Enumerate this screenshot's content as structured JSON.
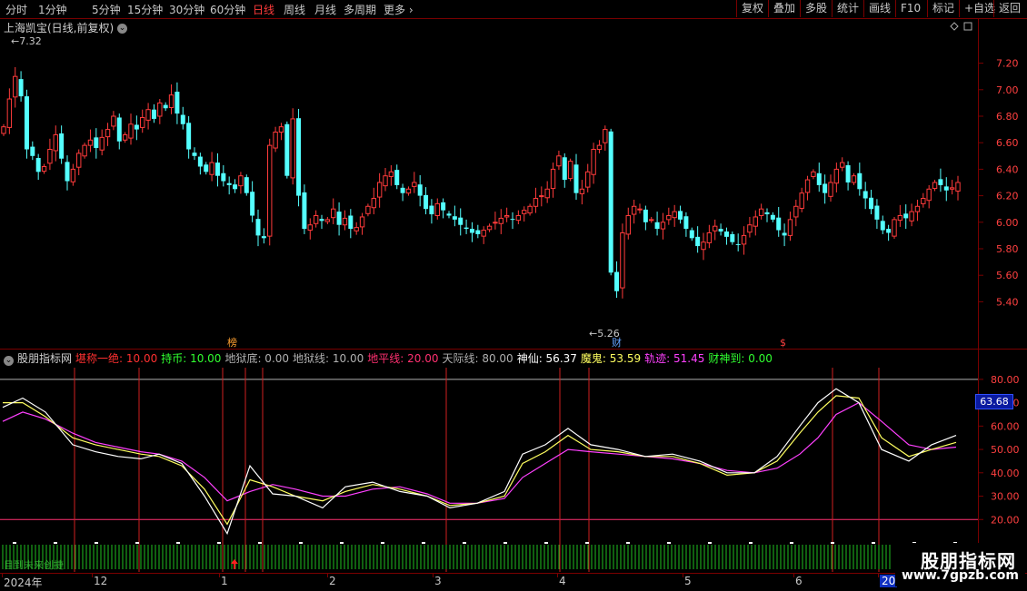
{
  "toolbar": {
    "timeframes": [
      "分时",
      "1分钟",
      "5分钟",
      "15分钟",
      "30分钟",
      "60分钟",
      "日线",
      "周线",
      "月线",
      "多周期",
      "更多"
    ],
    "active": "日线",
    "right_buttons": [
      "复权",
      "叠加",
      "多股",
      "统计",
      "画线",
      "F10",
      "标记",
      "+自选",
      "返回"
    ]
  },
  "main_chart": {
    "title": "上海凯宝(日线,前复权)",
    "high_label": "7.32",
    "low_label": "5.26",
    "y_ticks": [
      "7.20",
      "7.00",
      "6.80",
      "6.60",
      "6.40",
      "6.20",
      "6.00",
      "5.80",
      "5.60",
      "5.40"
    ],
    "markers": [
      "榜",
      "财",
      "$"
    ]
  },
  "indicator": {
    "name": "股朋指标网",
    "params": [
      {
        "label": "堪称一绝: ",
        "value": "10.00",
        "color": "#ff3030"
      },
      {
        "label": "持币: ",
        "value": "10.00",
        "color": "#30ff30"
      },
      {
        "label": "地狱底: ",
        "value": "0.00",
        "color": "#b0b0b0"
      },
      {
        "label": "地狱线: ",
        "value": "10.00",
        "color": "#b0b0b0"
      },
      {
        "label": "地平线: ",
        "value": "20.00",
        "color": "#ff3070"
      },
      {
        "label": "天际线: ",
        "value": "80.00",
        "color": "#b0b0b0"
      },
      {
        "label": "神仙: ",
        "value": "56.37",
        "color": "#ffffff"
      },
      {
        "label": "魔鬼: ",
        "value": "53.59",
        "color": "#ffff60"
      },
      {
        "label": "轨迹: ",
        "value": "51.45",
        "color": "#ff40ff"
      },
      {
        "label": "财神到: ",
        "value": "0.00",
        "color": "#30ff30"
      }
    ],
    "y_ticks": [
      "80.00",
      "70.00",
      "60.00",
      "50.00",
      "40.00",
      "30.00",
      "20.00"
    ],
    "current_value": "63.68",
    "bottom_text": "目到未来创捷"
  },
  "date_axis": {
    "labels": [
      "2024年",
      "12",
      "1",
      "2",
      "3",
      "4",
      "5",
      "6",
      "20"
    ]
  },
  "watermark": {
    "title": "股朋指标网",
    "url": "www.7gpzb.com"
  },
  "colors": {
    "up": "#ff3b3b",
    "down": "#54ffff",
    "grid_border": "#7a0000",
    "active_tab": "#ff3b3b"
  },
  "chart_data": {
    "type": "candlestick",
    "x_period": "daily, 2024-11 to 2025-06",
    "ylim": [
      5.2,
      7.35
    ],
    "close": [
      6.72,
      6.93,
      7.1,
      6.95,
      6.55,
      6.5,
      6.38,
      6.42,
      6.55,
      6.66,
      6.48,
      6.31,
      6.4,
      6.52,
      6.58,
      6.62,
      6.56,
      6.64,
      6.7,
      6.8,
      6.61,
      6.66,
      6.74,
      6.7,
      6.79,
      6.85,
      6.78,
      6.9,
      6.86,
      6.96,
      6.82,
      6.74,
      6.55,
      6.5,
      6.42,
      6.38,
      6.45,
      6.35,
      6.31,
      6.28,
      6.25,
      6.35,
      6.22,
      6.05,
      5.9,
      5.88,
      6.58,
      6.68,
      6.72,
      6.35,
      6.78,
      6.2,
      5.95,
      5.98,
      6.05,
      6.01,
      6.02,
      6.1,
      5.98,
      6.03,
      5.95,
      5.96,
      6.04,
      6.12,
      6.18,
      6.3,
      6.35,
      6.38,
      6.28,
      6.22,
      6.25,
      6.3,
      6.2,
      6.1,
      6.06,
      6.14,
      6.09,
      6.05,
      6.02,
      5.98,
      5.95,
      5.92,
      5.91,
      5.94,
      5.97,
      6.0,
      6.03,
      6.05,
      6.02,
      6.05,
      6.09,
      6.12,
      6.18,
      6.2,
      6.25,
      6.4,
      6.5,
      6.32,
      6.46,
      6.22,
      6.25,
      6.38,
      6.55,
      6.58,
      6.7,
      5.62,
      5.48,
      5.92,
      6.05,
      6.12,
      6.1,
      6.0,
      6.02,
      5.95,
      6.0,
      6.05,
      6.08,
      6.02,
      5.95,
      5.88,
      5.82,
      5.85,
      5.92,
      5.97,
      5.93,
      5.89,
      5.85,
      5.83,
      5.9,
      5.98,
      6.04,
      6.1,
      6.06,
      6.02,
      5.94,
      5.9,
      6.02,
      6.12,
      6.22,
      6.32,
      6.38,
      6.28,
      6.22,
      6.3,
      6.4,
      6.45,
      6.3,
      6.35,
      6.25,
      6.18,
      6.1,
      6.02,
      5.94,
      5.92,
      6.02,
      6.05,
      6.03,
      6.08,
      6.12,
      6.18,
      6.25,
      6.3,
      6.28,
      6.24,
      6.26,
      6.3
    ]
  }
}
